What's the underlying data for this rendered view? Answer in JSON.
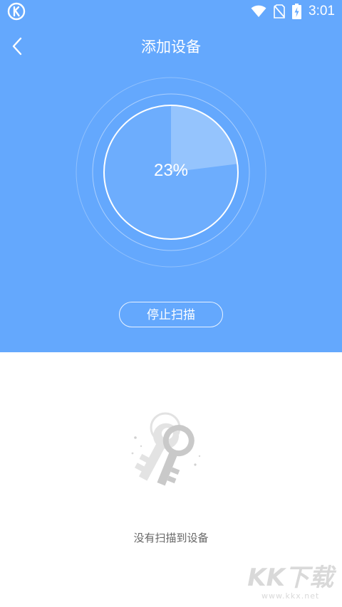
{
  "status_bar": {
    "time": "3:01",
    "icons": [
      "app-badge-icon",
      "wifi-icon",
      "no-sim-icon",
      "battery-charging-icon"
    ]
  },
  "header": {
    "title": "添加设备",
    "back_icon": "back-chevron-icon"
  },
  "scan": {
    "percent_label": "23%",
    "progress": 0.23,
    "stop_button": "停止扫描"
  },
  "empty_state": {
    "icon": "keys-icon",
    "message": "没有扫描到设备"
  },
  "watermark": {
    "main": "KK下载",
    "url": "www.kkx.net"
  },
  "colors": {
    "header_bg": "#64a8fd",
    "body_bg": "#ffffff",
    "text_on_blue": "#ffffff",
    "empty_text": "#666666"
  }
}
